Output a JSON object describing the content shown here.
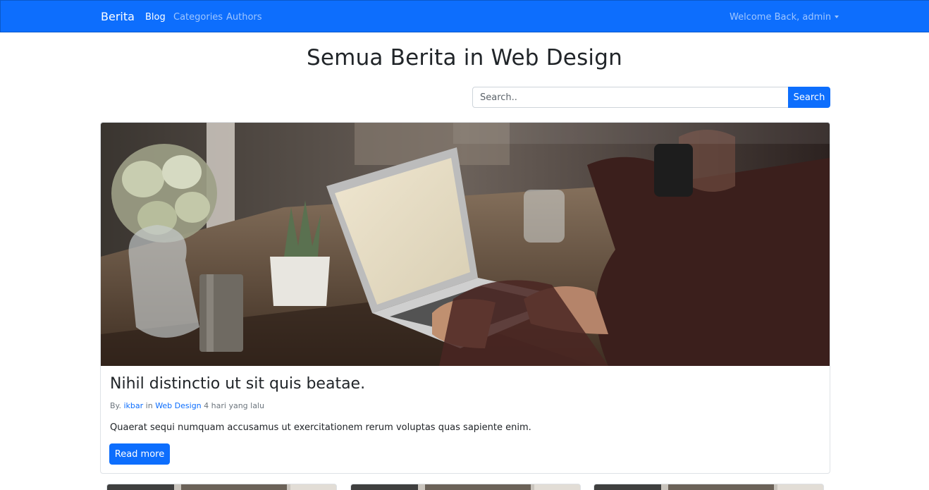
{
  "navbar": {
    "brand": "Berita",
    "links": [
      {
        "label": "Blog",
        "active": true
      },
      {
        "label": "Categories",
        "active": false
      },
      {
        "label": "Authors",
        "active": false
      }
    ],
    "user_menu": "Welcome Back, admin",
    "color": "#0d6efd"
  },
  "page": {
    "title": "Semua Berita in Web Design"
  },
  "search": {
    "placeholder": "Search..",
    "value": "",
    "button_label": "Search"
  },
  "hero_post": {
    "title": "Nihil distinctio ut sit quis beatae.",
    "meta_prefix": "By.",
    "author": "ikbar",
    "meta_in": "in",
    "category": "Web Design",
    "time": "4 hari yang lalu",
    "excerpt": "Quaerat sequi numquam accusamus ut exercitationem rerum voluptas quas sapiente enim.",
    "read_more_label": "Read more",
    "image_label": "man-using-laptop-on-desk-photo"
  },
  "more_posts_count": 3,
  "colors": {
    "primary": "#0d6efd",
    "text": "#212529",
    "muted": "#6c757d"
  }
}
